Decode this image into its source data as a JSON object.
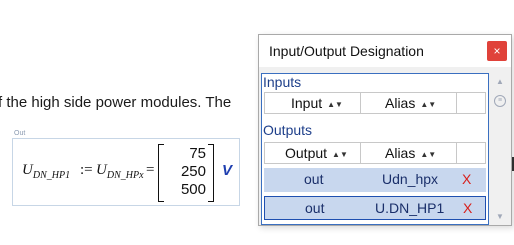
{
  "background": {
    "sentence_fragment": "f the high side power modules. The",
    "region_label": "Out"
  },
  "math": {
    "lhs_base": "U",
    "lhs_sub": "DN_HP1",
    "defeq": ":=",
    "rhs_base": "U",
    "rhs_sub": "DN_HPx",
    "eq": "=",
    "matrix": [
      "75",
      "250",
      "500"
    ],
    "unit": "V"
  },
  "dialog": {
    "title": "Input/Output Designation",
    "close": "×",
    "inputs_label": "Inputs",
    "outputs_label": "Outputs",
    "inputs_columns": [
      "Input",
      "Alias"
    ],
    "outputs_columns": [
      "Output",
      "Alias"
    ],
    "sort_icon": "▲▼",
    "rows": [
      {
        "type": "out",
        "alias": "Udn_hpx",
        "delete": "X"
      },
      {
        "type": "out",
        "alias": "U.DN_HP1",
        "delete": "X"
      }
    ]
  },
  "colors": {
    "close_button": "#e0423a",
    "selection": "#c8d7ee",
    "section_label": "#1e3f8a",
    "unit": "#1f3fb0",
    "delete": "#d8201c"
  }
}
